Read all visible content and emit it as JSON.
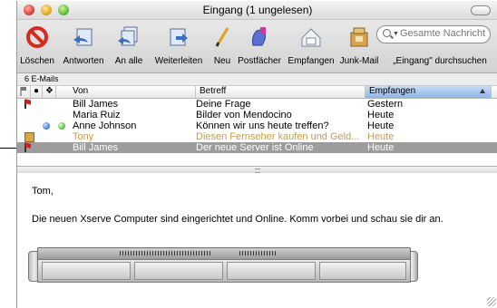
{
  "window": {
    "title": "Eingang (1 ungelesen)"
  },
  "toolbar": {
    "items": [
      {
        "label": "Löschen",
        "icon": "delete-icon"
      },
      {
        "label": "Antworten",
        "icon": "reply-icon"
      },
      {
        "label": "An alle",
        "icon": "reply-all-icon"
      },
      {
        "label": "Weiterleiten",
        "icon": "forward-icon"
      },
      {
        "label": "Neu",
        "icon": "new-message-icon"
      },
      {
        "label": "Postfächer",
        "icon": "mailboxes-icon"
      },
      {
        "label": "Empfangen",
        "icon": "get-mail-icon"
      },
      {
        "label": "Junk-Mail",
        "icon": "junk-mail-icon"
      }
    ],
    "search": {
      "placeholder": "Gesamte Nachricht",
      "label": "„Eingang\" durchsuchen"
    }
  },
  "count_label": "6 E-Mails",
  "columns": {
    "von": "Von",
    "betreff": "Betreff",
    "empfangen": "Empfangen"
  },
  "messages": [
    {
      "from": "Bill James",
      "subject": "Deine Frage",
      "received": "Gestern",
      "flagged": true
    },
    {
      "from": "Maria Ruiz",
      "subject": "Bilder von Mendocino",
      "received": "Heute"
    },
    {
      "from": "Anne Johnson",
      "subject": "Können wir uns heute treffen?",
      "received": "Heute",
      "status": [
        "unread",
        "online"
      ]
    },
    {
      "from": "Tony",
      "subject": "Diesen Fernseher kaufen und Geld...",
      "received": "Heute",
      "junk": true
    },
    {
      "from": "Bill James",
      "subject": "Der neue Server ist Online",
      "received": "Heute",
      "flagged": true,
      "selected": true
    }
  ],
  "preview": {
    "greeting": "Tom,",
    "body": "Die neuen Xserve Computer sind eingerichtet und Online. Komm vorbei und schau sie dir an."
  },
  "colors": {
    "selected_row": "#9c9c9c",
    "junk_text": "#c89a50",
    "sorted_header": "#8db3e6"
  }
}
